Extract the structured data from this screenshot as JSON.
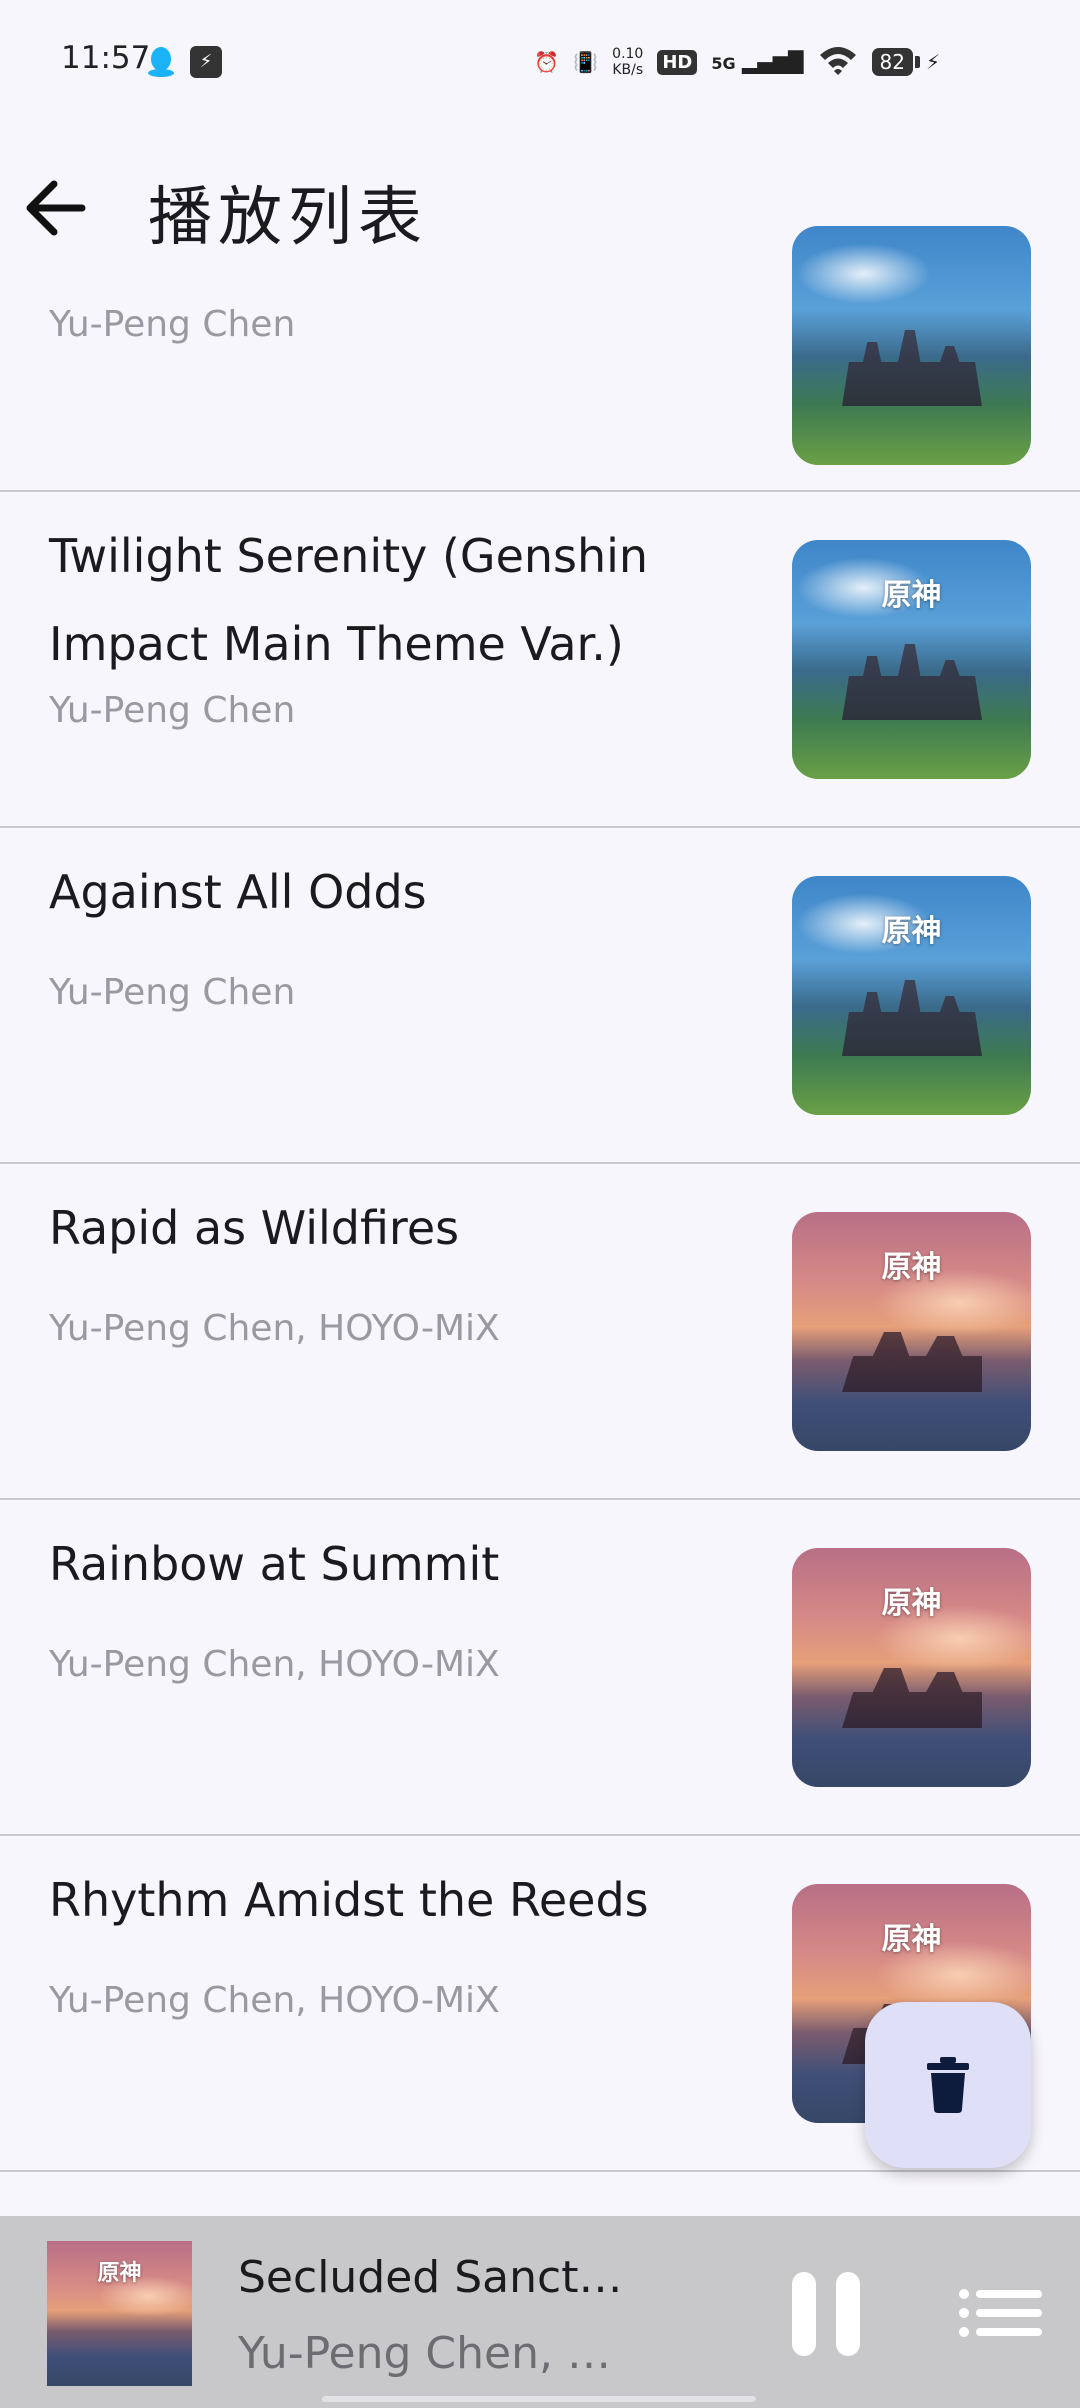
{
  "status": {
    "time": "11:57",
    "net_speed_value": "0.10",
    "net_speed_unit": "KB/s",
    "hd": "HD",
    "network": "5G",
    "battery": "82"
  },
  "header": {
    "title": "播放列表"
  },
  "songs": [
    {
      "title": "",
      "artist": "Yu-Peng Chen",
      "art": "blue"
    },
    {
      "title": "Twilight Serenity (Genshin Impact Main Theme Var.)",
      "artist": "Yu-Peng Chen",
      "art": "blue"
    },
    {
      "title": "Against All Odds",
      "artist": "Yu-Peng Chen",
      "art": "blue"
    },
    {
      "title": "Rapid as Wildfires",
      "artist": "Yu-Peng Chen, HOYO-MiX",
      "art": "sunset"
    },
    {
      "title": "Rainbow at Summit",
      "artist": "Yu-Peng Chen, HOYO-MiX",
      "art": "sunset"
    },
    {
      "title": "Rhythm Amidst the Reeds",
      "artist": "Yu-Peng Chen, HOYO-MiX",
      "art": "sunset"
    }
  ],
  "album_logo": "原神",
  "player": {
    "title": "Secluded Sanct…",
    "artist": "Yu-Peng Chen, …"
  },
  "colors": {
    "background": "#f7f6fc",
    "fab": "#dfe0f7",
    "player_bar": "#c8c8cb",
    "secondary_text": "#9a99a2"
  }
}
